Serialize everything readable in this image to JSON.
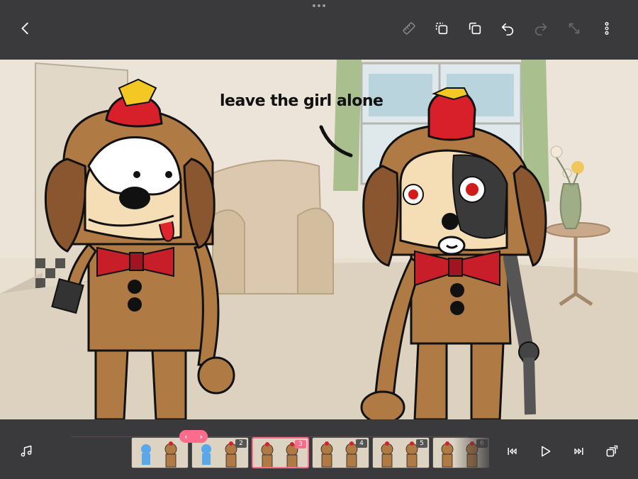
{
  "toolbar": {
    "back": "back-icon",
    "icons": [
      "ruler-icon",
      "copy-frame-icon",
      "duplicate-icon",
      "undo-icon",
      "redo-icon",
      "resize-icon",
      "more-icon"
    ]
  },
  "canvas": {
    "caption": "leave the girl alone"
  },
  "timeline": {
    "frames": [
      {
        "number": "",
        "active": false
      },
      {
        "number": "2",
        "active": false
      },
      {
        "number": "3",
        "active": true
      },
      {
        "number": "4",
        "active": false
      },
      {
        "number": "5",
        "active": false
      },
      {
        "number": "6",
        "active": false
      }
    ],
    "scrubber_left": "‹",
    "scrubber_right": "›"
  },
  "colors": {
    "accent": "#ff6b8a",
    "bar": "#3a3a3c",
    "dog_brown": "#b07a45",
    "hat_red": "#d8202a"
  }
}
